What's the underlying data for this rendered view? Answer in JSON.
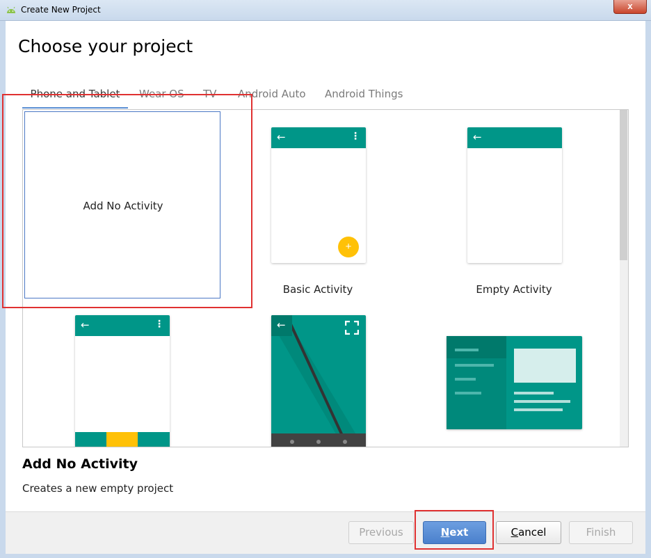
{
  "window": {
    "title": "Create New Project",
    "close_glyph": "x"
  },
  "heading": "Choose your project",
  "tabs": [
    {
      "label": "Phone and Tablet",
      "active": true
    },
    {
      "label": "Wear OS",
      "active": false
    },
    {
      "label": "TV",
      "active": false
    },
    {
      "label": "Android Auto",
      "active": false
    },
    {
      "label": "Android Things",
      "active": false
    }
  ],
  "templates": [
    {
      "label": "Add No Activity",
      "selected": true
    },
    {
      "label": "Basic Activity"
    },
    {
      "label": "Empty Activity"
    },
    {
      "label": ""
    },
    {
      "label": ""
    },
    {
      "label": ""
    }
  ],
  "icons": {
    "back_arrow": "←",
    "overflow": "⋮",
    "fab_plus": "+"
  },
  "selection": {
    "title": "Add No Activity",
    "description": "Creates a new empty project"
  },
  "buttons": {
    "previous": "Previous",
    "next_mnemonic": "N",
    "next_rest": "ext",
    "cancel_mnemonic": "C",
    "cancel_rest": "ancel",
    "finish": "Finish"
  },
  "colors": {
    "teal": "#009688",
    "amber": "#ffc107",
    "highlight_red": "#e03131",
    "selection_blue": "#4a77c4"
  }
}
